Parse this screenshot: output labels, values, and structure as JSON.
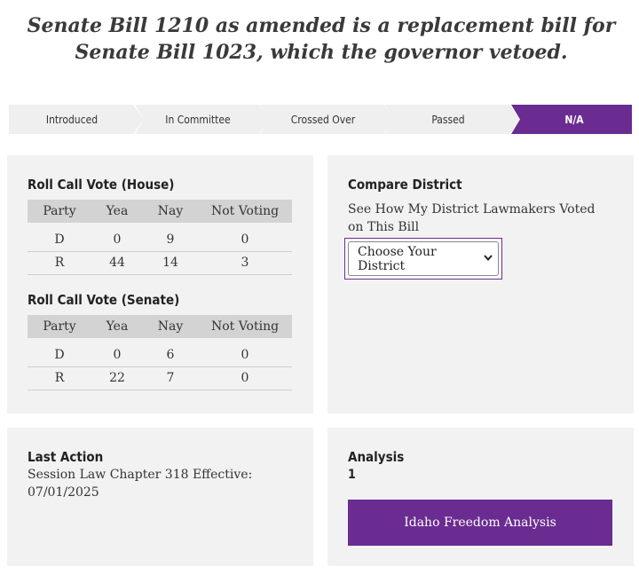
{
  "headline": "Senate Bill 1210 as amended is a replacement bill for Senate Bill 1023, which the governor vetoed.",
  "progress": {
    "steps": [
      "Introduced",
      "In Committee",
      "Crossed Over",
      "Passed",
      "N/A"
    ],
    "active_index": 4,
    "active_color": "#6a2c91",
    "inactive_color": "#efefef"
  },
  "house": {
    "title": "Roll Call Vote (House)",
    "headers": [
      "Party",
      "Yea",
      "Nay",
      "Not Voting"
    ],
    "rows": [
      [
        "D",
        "0",
        "9",
        "0"
      ],
      [
        "R",
        "44",
        "14",
        "3"
      ]
    ]
  },
  "senate": {
    "title": "Roll Call Vote (Senate)",
    "headers": [
      "Party",
      "Yea",
      "Nay",
      "Not Voting"
    ],
    "rows": [
      [
        "D",
        "0",
        "6",
        "0"
      ],
      [
        "R",
        "22",
        "7",
        "0"
      ]
    ]
  },
  "compare": {
    "title": "Compare District",
    "description": "See How My District Lawmakers Voted on This Bill",
    "select_value": "Choose Your District"
  },
  "last_action": {
    "title": "Last Action",
    "text": "Session Law Chapter 318 Effective: 07/01/2025"
  },
  "analysis": {
    "title": "Analysis",
    "count": "1",
    "button_label": "Idaho Freedom Analysis"
  }
}
